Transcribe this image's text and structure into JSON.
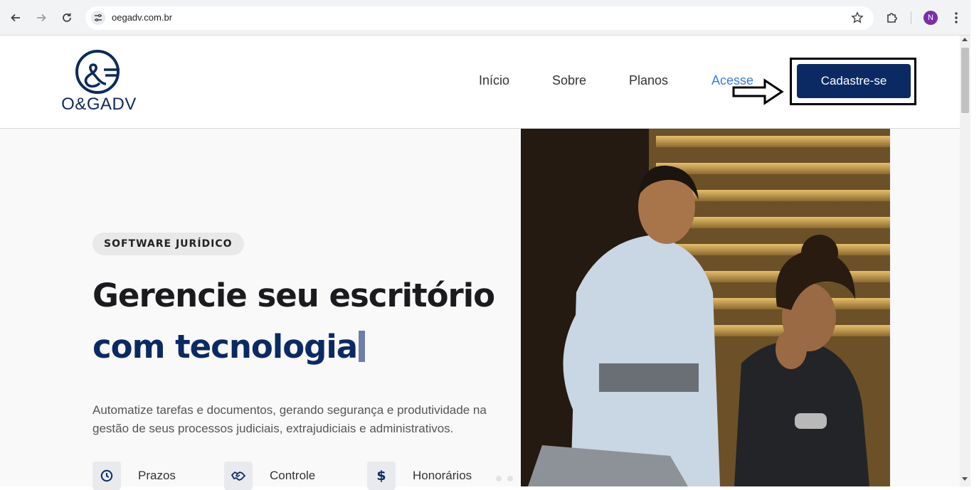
{
  "browser": {
    "url": "oegadv.com.br",
    "profile_initial": "N"
  },
  "site": {
    "logo_text": "O&GADV",
    "nav": [
      {
        "label": "Início"
      },
      {
        "label": "Sobre"
      },
      {
        "label": "Planos"
      },
      {
        "label": "Acesse"
      }
    ],
    "cta_label": "Cadastre-se"
  },
  "hero": {
    "badge": "SOFTWARE JURÍDICO",
    "title_line1": "Gerencie seu escritório",
    "title_line2": "com tecnologia",
    "description": "Automatize tarefas e documentos, gerando segurança e produtividade na gestão de seus processos judiciais, extrajudiciais e administrativos.",
    "features": [
      {
        "label": "Prazos",
        "icon": "clock-icon"
      },
      {
        "label": "Controle",
        "icon": "handshake-icon"
      },
      {
        "label": "Honorários",
        "icon": "dollar-icon"
      }
    ]
  },
  "colors": {
    "brand": "#0b2a63",
    "accent_link": "#3b7dd8",
    "hero_bg": "#f9f9f9"
  }
}
